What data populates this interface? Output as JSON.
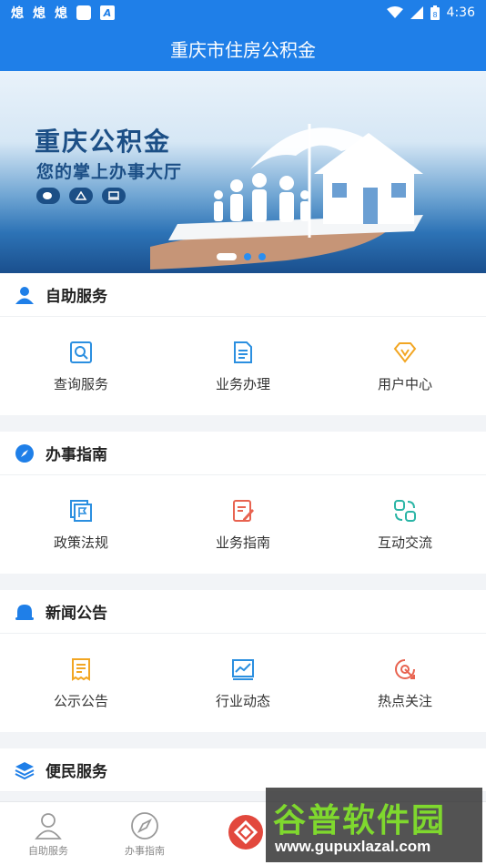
{
  "status_bar": {
    "glyphs": [
      "熄",
      "熄",
      "熄"
    ],
    "a_label": "A",
    "battery_level": "8",
    "time": "4:36"
  },
  "header": {
    "title": "重庆市住房公积金"
  },
  "banner": {
    "title": "重庆公积金",
    "subtitle": "您的掌上办事大厅",
    "active_slide": 1,
    "slide_count": 3
  },
  "sections": [
    {
      "title": "自助服务",
      "icon": "person-icon",
      "items": [
        {
          "label": "查询服务",
          "icon": "search-doc-icon"
        },
        {
          "label": "业务办理",
          "icon": "document-icon"
        },
        {
          "label": "用户中心",
          "icon": "diamond-v-icon"
        }
      ]
    },
    {
      "title": "办事指南",
      "icon": "compass-icon",
      "items": [
        {
          "label": "政策法规",
          "icon": "flag-docs-icon"
        },
        {
          "label": "业务指南",
          "icon": "edit-doc-icon"
        },
        {
          "label": "互动交流",
          "icon": "interaction-icon"
        }
      ]
    },
    {
      "title": "新闻公告",
      "icon": "bell-icon",
      "items": [
        {
          "label": "公示公告",
          "icon": "notice-icon"
        },
        {
          "label": "行业动态",
          "icon": "chart-icon"
        },
        {
          "label": "热点关注",
          "icon": "hot-target-icon"
        }
      ]
    },
    {
      "title": "便民服务",
      "icon": "layers-icon",
      "items": []
    }
  ],
  "bottom_nav": [
    {
      "label": "自助服务",
      "icon": "person-outline-icon"
    },
    {
      "label": "办事指南",
      "icon": "compass-outline-icon"
    }
  ],
  "watermark": {
    "text": "谷普软件园",
    "url": "www.gupuxlazal.com"
  },
  "colors": {
    "primary": "#1f7fe8",
    "blue_icon": "#2b8fe0",
    "orange_icon": "#f2a623",
    "red_icon": "#e86350",
    "green_icon": "#2bb5a6"
  }
}
